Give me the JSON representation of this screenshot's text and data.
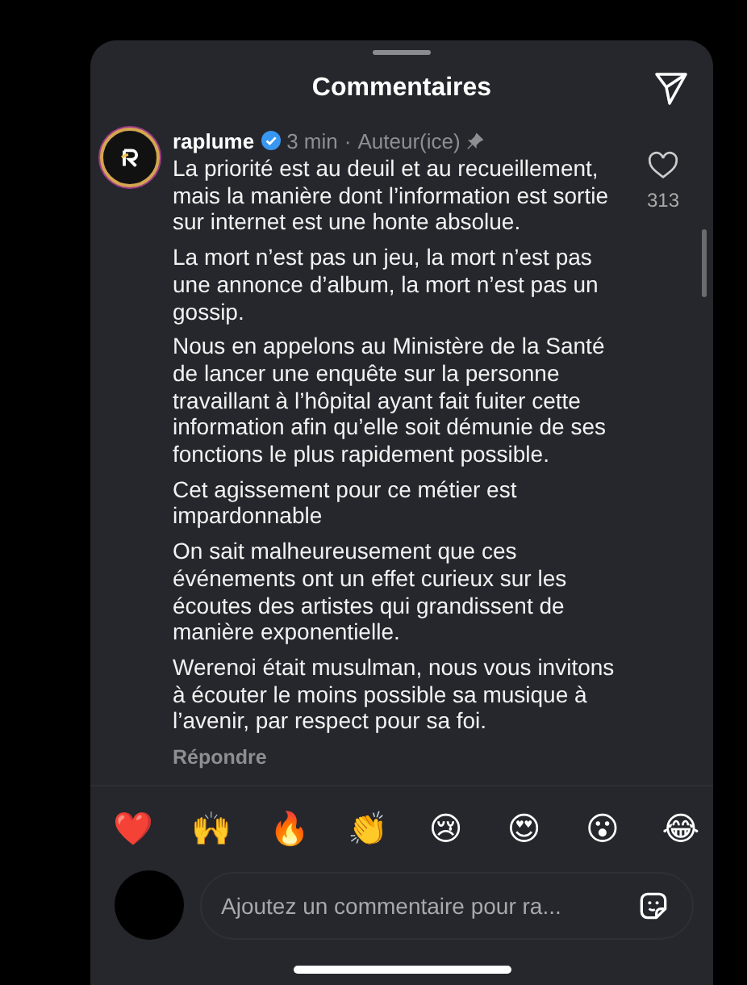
{
  "header": {
    "title": "Commentaires"
  },
  "comment": {
    "username": "raplume",
    "verified": true,
    "time": "3 min",
    "separator": "·",
    "role": "Auteur(ice)",
    "pinned": true,
    "paragraphs": [
      "La priorité est au deuil et au recueillement, mais la manière dont l’information est sortie sur internet est une honte absolue.",
      "La mort n’est pas un jeu, la mort n’est pas une annonce d’album, la mort n’est pas un gossip.",
      "Nous en appelons au Ministère de la Santé de lancer une enquête sur la personne travaillant à l’hôpital ayant fait fuiter cette information afin qu’elle soit démunie de ses fonctions le plus rapidement possible.",
      "Cet agissement pour ce métier est impardonnable",
      "On sait malheureusement que ces événements ont un effet curieux sur les écoutes des artistes qui grandissent de manière exponentielle.",
      "Werenoi était musulman, nous vous invitons à écouter le moins possible sa musique à l’avenir, par respect pour sa foi."
    ],
    "reply": "Répondre",
    "likes": "313",
    "liked": false
  },
  "reactions": [
    "❤️",
    "🙌",
    "🔥",
    "👏",
    "😢",
    "😍",
    "😮",
    "😂"
  ],
  "composer": {
    "placeholder": "Ajoutez un commentaire pour ra..."
  }
}
